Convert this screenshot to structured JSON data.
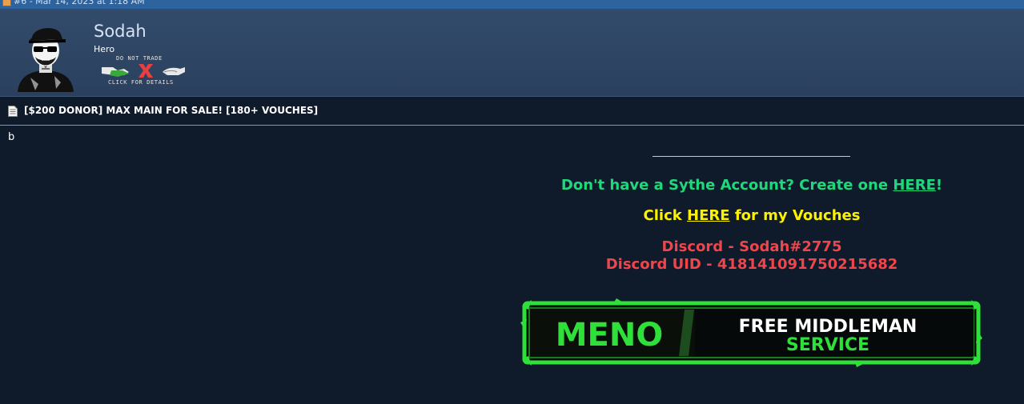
{
  "post_header": {
    "text": "#6 - Mar 14, 2023 at 1:18 AM"
  },
  "user": {
    "name": "Sodah",
    "title": "Hero",
    "badge": {
      "top_text": "DO NOT TRADE",
      "bottom_text": "CLICK FOR DETAILS"
    }
  },
  "thread": {
    "title": "[$200 DONOR] MAX MAIN FOR SALE! [180+ VOUCHES]"
  },
  "post": {
    "body": "b"
  },
  "signature": {
    "account_prefix": "Don't have a Sythe Account? Create one ",
    "account_link": "HERE",
    "account_suffix": "!",
    "vouch_prefix": "Click ",
    "vouch_link": "HERE",
    "vouch_suffix": " for my Vouches",
    "discord": "Discord - Sodah#2775",
    "discord_uid": "Discord UID - 418141091750215682"
  },
  "banner": {
    "left_text": "MENO",
    "right_line1": "FREE MIDDLEMAN",
    "right_line2": "SERVICE"
  },
  "colors": {
    "accent_green": "#1ed97b",
    "accent_yellow": "#fcf200",
    "accent_red": "#f0454a",
    "banner_green": "#2fe03a"
  }
}
